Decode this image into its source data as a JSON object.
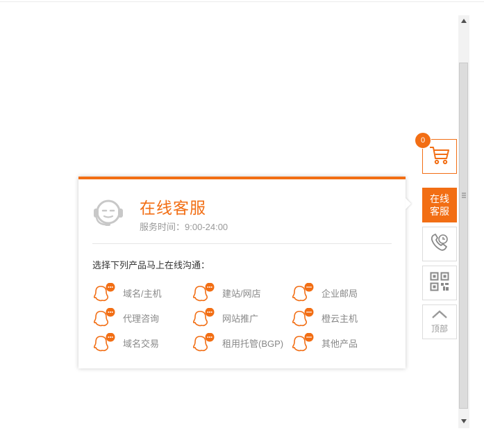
{
  "colors": {
    "accent": "#f26e14",
    "muted": "#888888"
  },
  "popup": {
    "title": "在线客服",
    "hours": "服务时间：9:00-24:00",
    "prompt": "选择下列产品马上在线沟通：",
    "products": [
      {
        "label": "域名/主机",
        "icon": "qq-chat-icon"
      },
      {
        "label": "建站/网店",
        "icon": "qq-chat-icon"
      },
      {
        "label": "企业邮局",
        "icon": "qq-chat-icon"
      },
      {
        "label": "代理咨询",
        "icon": "qq-chat-icon"
      },
      {
        "label": "网站推广",
        "icon": "qq-chat-icon"
      },
      {
        "label": "橙云主机",
        "icon": "qq-chat-icon"
      },
      {
        "label": "域名交易",
        "icon": "qq-chat-icon"
      },
      {
        "label": "租用托管(BGP)",
        "icon": "qq-chat-icon"
      },
      {
        "label": "其他产品",
        "icon": "qq-chat-icon"
      }
    ]
  },
  "sidebar": {
    "cart_count": "0",
    "kefu_line1": "在线",
    "kefu_line2": "客服",
    "top_label": "顶部",
    "icons": [
      "cart-icon",
      "phone-icon",
      "qr-code-icon",
      "chevron-up-icon"
    ]
  }
}
